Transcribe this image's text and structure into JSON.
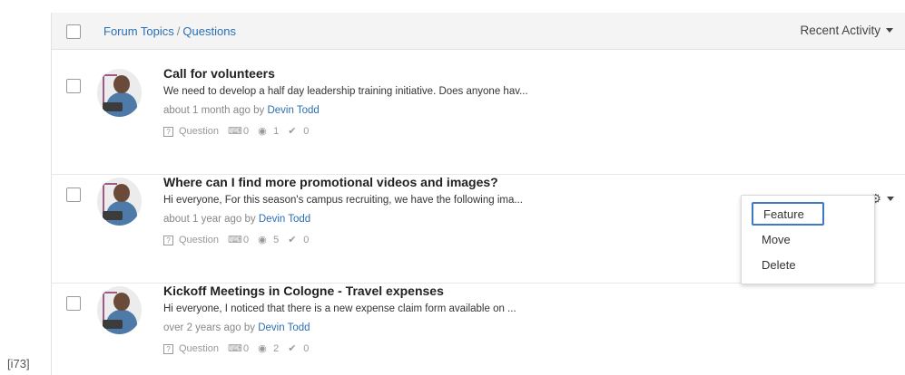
{
  "header": {
    "breadcrumb_root": "Forum Topics",
    "breadcrumb_sep": "/",
    "breadcrumb_current": "Questions",
    "sort_label": "Recent Activity"
  },
  "topics": [
    {
      "title": "Call for volunteers",
      "excerpt": "We need to develop a half day leadership training initiative. Does anyone hav...",
      "meta_prefix": "about 1 month ago by",
      "author": "Devin Todd",
      "type": "Question",
      "replies": "0",
      "views": "1",
      "likes": "0"
    },
    {
      "title": "Where can I find more promotional videos and images?",
      "excerpt": "Hi everyone, For this season's campus recruiting, we have the following ima...",
      "meta_prefix": "about 1 year ago by",
      "author": "Devin Todd",
      "type": "Question",
      "replies": "0",
      "views": "5",
      "likes": "0"
    },
    {
      "title": "Kickoff Meetings in Cologne - Travel expenses",
      "excerpt": "Hi everyone, I noticed that there is a new expense claim form available on ...",
      "meta_prefix": "over 2 years ago by",
      "author": "Devin Todd",
      "type": "Question",
      "replies": "0",
      "views": "2",
      "likes": "0"
    }
  ],
  "menu": {
    "items": [
      "Feature",
      "Move",
      "Delete"
    ]
  },
  "corner_label": "[i73]"
}
